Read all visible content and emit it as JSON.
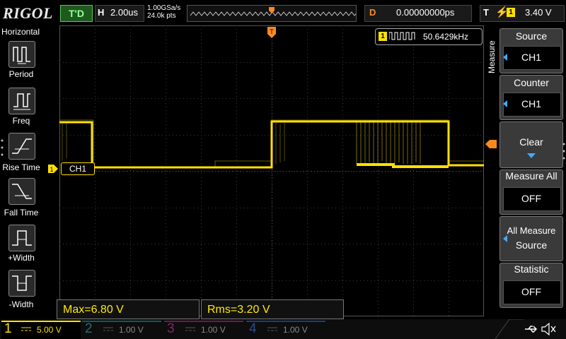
{
  "header": {
    "logo": "RIGOL",
    "trigger_status": "T'D",
    "horizontal_label": "H",
    "timebase": "2.00us",
    "sample_rate": "1.00GSa/s",
    "mem_depth": "24.0k pts",
    "delay_label": "D",
    "delay_value": "0.00000000ps",
    "trigger_label": "T",
    "trigger_channel": "1",
    "trigger_level": "3.40 V"
  },
  "left_menu": {
    "title": "Horizontal",
    "items": [
      {
        "label": "Period",
        "icon": "period-icon"
      },
      {
        "label": "Freq",
        "icon": "frequency-icon"
      },
      {
        "label": "Rise Time",
        "icon": "rise-time-icon"
      },
      {
        "label": "Fall Time",
        "icon": "fall-time-icon"
      },
      {
        "label": "+Width",
        "icon": "positive-width-icon"
      },
      {
        "label": "-Width",
        "icon": "negative-width-icon"
      }
    ]
  },
  "display": {
    "ch1_marker": "1",
    "ch1_label": "CH1",
    "counter_channel": "1",
    "counter_value": "50.6429kHz",
    "trigger_position_marker": "T"
  },
  "right_menu": {
    "tab": "Measure",
    "source": {
      "title": "Source",
      "value": "CH1"
    },
    "counter": {
      "title": "Counter",
      "value": "CH1"
    },
    "clear": {
      "title": "Clear"
    },
    "measure_all": {
      "title": "Measure All",
      "value": "OFF"
    },
    "all_measure_source": {
      "title_line1": "All Measure",
      "title_line2": "Source"
    },
    "statistic": {
      "title": "Statistic",
      "value": "OFF"
    }
  },
  "measurements": {
    "max": "Max=6.80 V",
    "rms": "Rms=3.20 V"
  },
  "channels": [
    {
      "num": "1",
      "scale": "5.00 V",
      "color": "#ffe000",
      "active": true
    },
    {
      "num": "2",
      "scale": "1.00 V",
      "color": "#00d8e8",
      "active": false
    },
    {
      "num": "3",
      "scale": "1.00 V",
      "color": "#ff40c0",
      "active": false
    },
    {
      "num": "4",
      "scale": "1.00 V",
      "color": "#3080ff",
      "active": false
    }
  ],
  "colors": {
    "ch1": "#ffe000",
    "trigger": "#ff8a1e",
    "accent": "#44aaff"
  }
}
